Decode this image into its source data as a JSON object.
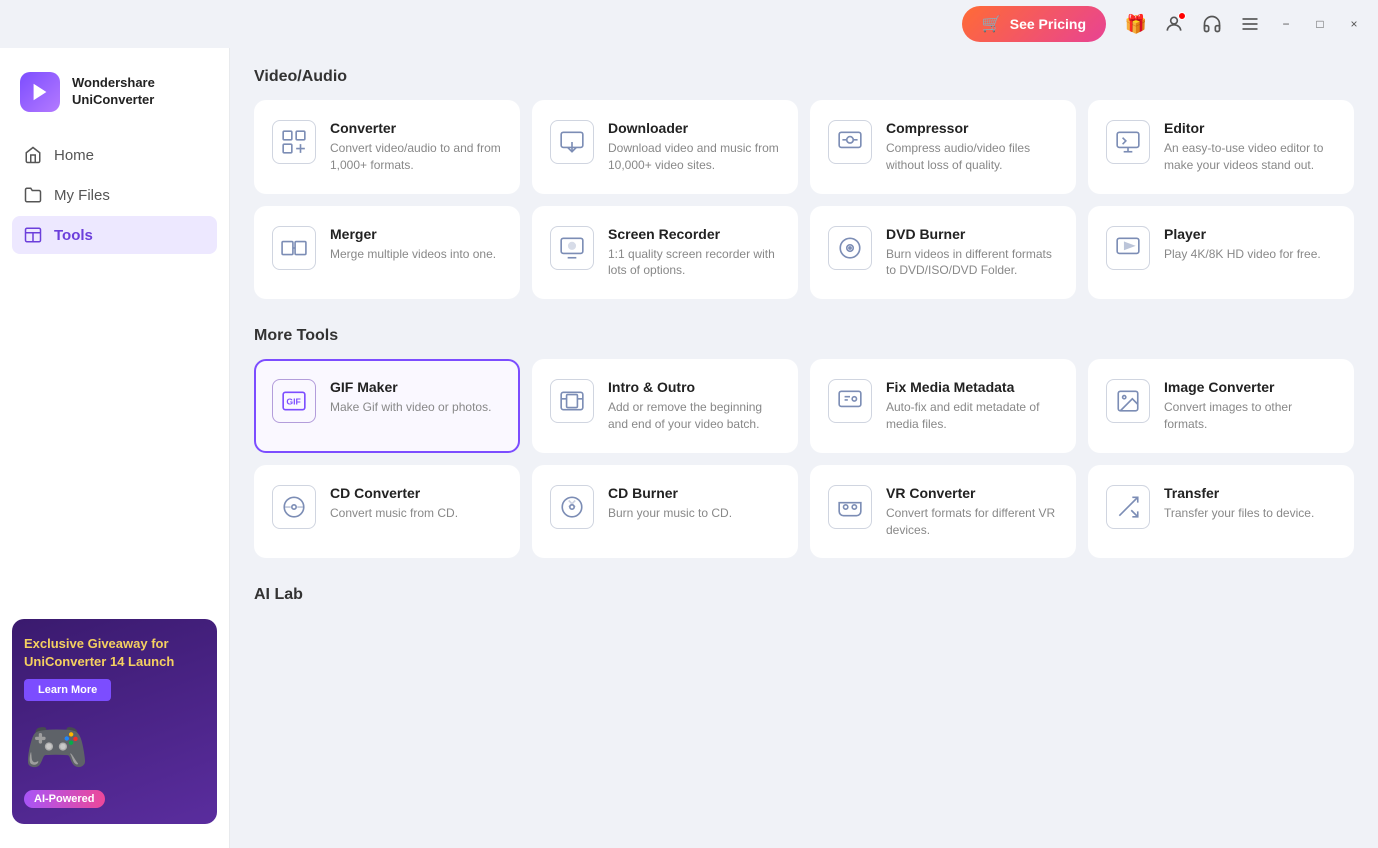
{
  "titlebar": {
    "see_pricing_label": "See Pricing",
    "minimize_label": "−",
    "maximize_label": "□",
    "close_label": "×"
  },
  "brand": {
    "name_line1": "Wondershare",
    "name_line2": "UniConverter"
  },
  "sidebar": {
    "items": [
      {
        "id": "home",
        "label": "Home",
        "active": false
      },
      {
        "id": "my-files",
        "label": "My Files",
        "active": false
      },
      {
        "id": "tools",
        "label": "Tools",
        "active": true
      }
    ]
  },
  "promo": {
    "title": "Exclusive Giveaway for UniConverter 14 Launch",
    "learn_more": "Learn More",
    "ai_label": "AI-Powered"
  },
  "video_audio": {
    "section_title": "Video/Audio",
    "tools": [
      {
        "name": "Converter",
        "desc": "Convert video/audio to and from 1,000+ formats."
      },
      {
        "name": "Downloader",
        "desc": "Download video and music from 10,000+ video sites."
      },
      {
        "name": "Compressor",
        "desc": "Compress audio/video files without loss of quality."
      },
      {
        "name": "Editor",
        "desc": "An easy-to-use video editor to make your videos stand out."
      },
      {
        "name": "Merger",
        "desc": "Merge multiple videos into one."
      },
      {
        "name": "Screen Recorder",
        "desc": "1:1 quality screen recorder with lots of options."
      },
      {
        "name": "DVD Burner",
        "desc": "Burn videos in different formats to DVD/ISO/DVD Folder."
      },
      {
        "name": "Player",
        "desc": "Play 4K/8K HD video for free."
      }
    ]
  },
  "more_tools": {
    "section_title": "More Tools",
    "tools": [
      {
        "name": "GIF Maker",
        "desc": "Make Gif with video or photos.",
        "active": true
      },
      {
        "name": "Intro & Outro",
        "desc": "Add or remove the beginning and end of your video batch."
      },
      {
        "name": "Fix Media Metadata",
        "desc": "Auto-fix and edit metadate of media files."
      },
      {
        "name": "Image Converter",
        "desc": "Convert images to other formats."
      },
      {
        "name": "CD Converter",
        "desc": "Convert music from CD."
      },
      {
        "name": "CD Burner",
        "desc": "Burn your music to CD."
      },
      {
        "name": "VR Converter",
        "desc": "Convert formats for different VR devices."
      },
      {
        "name": "Transfer",
        "desc": "Transfer your files to device."
      }
    ]
  },
  "ai_lab": {
    "section_title": "AI Lab"
  }
}
